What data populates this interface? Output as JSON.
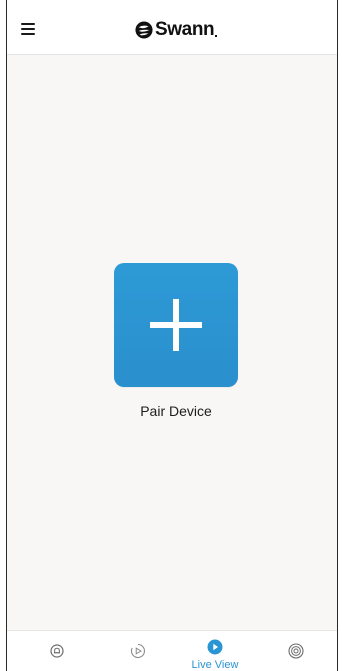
{
  "header": {
    "brand": "Swann"
  },
  "main": {
    "pair_label": "Pair Device"
  },
  "tabbar": {
    "tabs": [
      {
        "icon": "alert-bell-icon",
        "label": "",
        "active": false
      },
      {
        "icon": "playback-icon",
        "label": "",
        "active": false
      },
      {
        "icon": "live-view-icon",
        "label": "Live View",
        "active": true
      },
      {
        "icon": "devices-icon",
        "label": "",
        "active": false
      }
    ]
  },
  "colors": {
    "accent": "#2a95d3",
    "tile": "#2d9ad6",
    "background": "#f8f7f5"
  }
}
